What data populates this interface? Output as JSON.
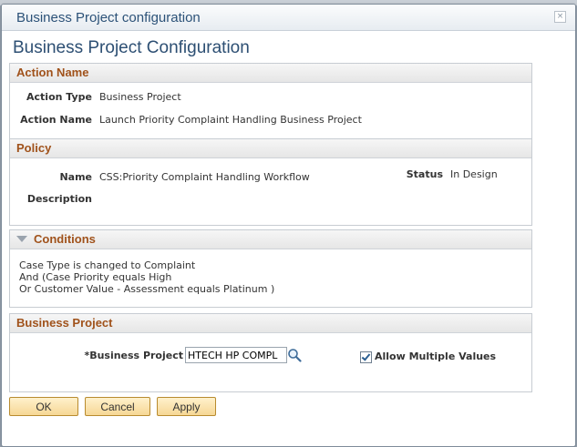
{
  "dialog": {
    "title": "Business Project configuration",
    "close_glyph": "×"
  },
  "page_title": "Business Project Configuration",
  "action_section": {
    "header": "Action Name",
    "action_type_label": "Action Type",
    "action_type_value": "Business Project",
    "action_name_label": "Action Name",
    "action_name_value": "Launch Priority Complaint Handling Business Project"
  },
  "policy_section": {
    "header": "Policy",
    "name_label": "Name",
    "name_value": "CSS:Priority Complaint Handling Workflow",
    "status_label": "Status",
    "status_value": "In Design",
    "description_label": "Description",
    "description_value": ""
  },
  "conditions_section": {
    "header": "Conditions",
    "lines": [
      "Case Type is changed to Complaint",
      "And (Case Priority equals High",
      "Or Customer Value - Assessment equals Platinum )"
    ]
  },
  "business_project_section": {
    "header": "Business Project",
    "field_label": "*Business Project",
    "field_value": "HTECH HP COMPL",
    "allow_multiple_label": "Allow Multiple Values",
    "allow_multiple_checked": true
  },
  "buttons": {
    "ok": "OK",
    "cancel": "Cancel",
    "apply": "Apply"
  },
  "icons": {
    "lookup": "search-icon",
    "collapse": "triangle-down-icon",
    "close": "close-icon"
  },
  "colors": {
    "section_header_text": "#a0521b",
    "title_text": "#2d4f73",
    "button_fill": "#f6d795"
  }
}
